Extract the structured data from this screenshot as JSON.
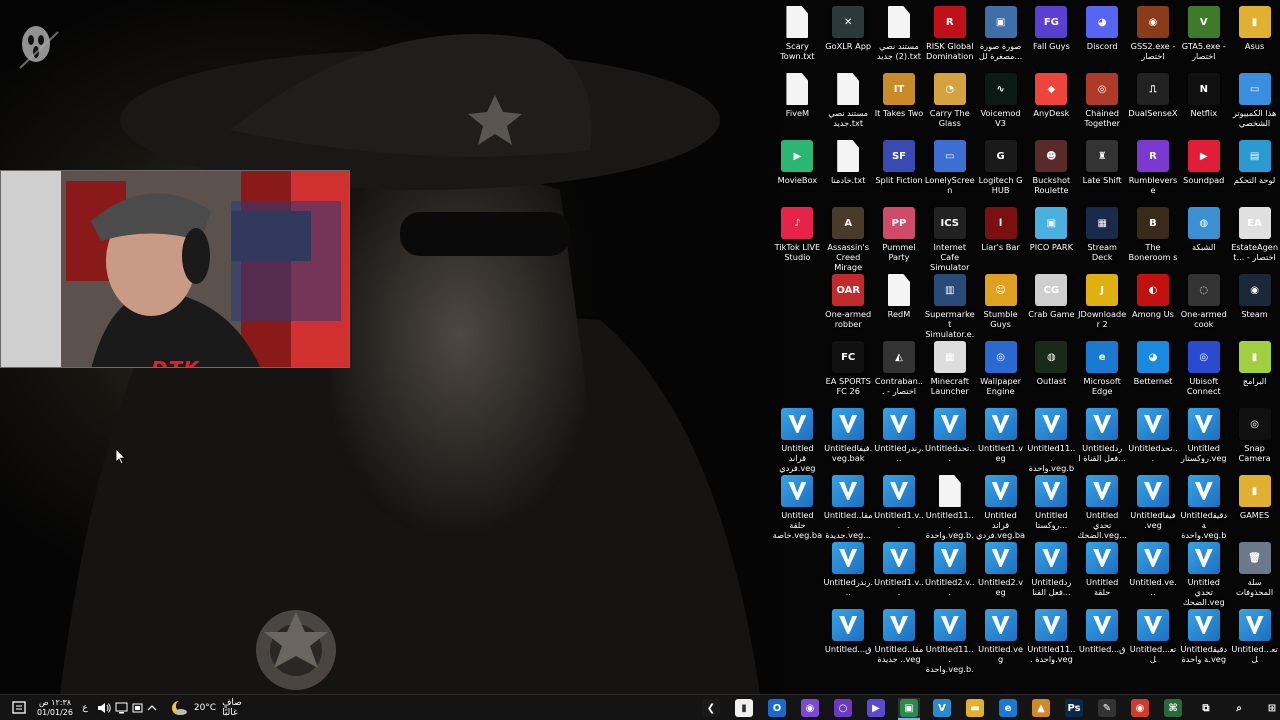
{
  "desktop": {
    "icons": [
      {
        "label": "Scary Town.txt",
        "kind": "doc"
      },
      {
        "label": "GoXLR App",
        "kind": "app",
        "color": "#2a3a3a",
        "glyph": "✕"
      },
      {
        "label": "مستند نصي (2) جديد.txt",
        "kind": "doc"
      },
      {
        "label": "RISK Global Domination",
        "kind": "app",
        "color": "#c0101a",
        "glyph": "R"
      },
      {
        "label": "صورة صورة مصغرة لل...",
        "kind": "app",
        "color": "#3f6fa8",
        "glyph": "▣"
      },
      {
        "label": "Fall Guys",
        "kind": "app",
        "color": "#5a3fd0",
        "glyph": "FG"
      },
      {
        "label": "Discord",
        "kind": "app",
        "color": "#5865f2",
        "glyph": "◕"
      },
      {
        "label": "GSS2.exe - اختصار",
        "kind": "app",
        "color": "#8a3b1a",
        "glyph": "◉"
      },
      {
        "label": "GTA5.exe - اختصار",
        "kind": "app",
        "color": "#3d7a2a",
        "glyph": "V"
      },
      {
        "label": "Asus",
        "kind": "app",
        "color": "#e0b030",
        "glyph": "▮"
      },
      {
        "label": "FiveM",
        "kind": "doc"
      },
      {
        "label": "مستند نصي جديد.txt",
        "kind": "doc"
      },
      {
        "label": "It Takes Two",
        "kind": "app",
        "color": "#c98a2a",
        "glyph": "IT"
      },
      {
        "label": "Carry The Glass",
        "kind": "app",
        "color": "#d4a340",
        "glyph": "◔"
      },
      {
        "label": "Voicemod V3",
        "kind": "app",
        "color": "#0c1a16",
        "glyph": "∿"
      },
      {
        "label": "AnyDesk",
        "kind": "app",
        "color": "#ef443b",
        "glyph": "◆"
      },
      {
        "label": "Chained Together",
        "kind": "app",
        "color": "#b03a2a",
        "glyph": "◎"
      },
      {
        "label": "DualSenseX",
        "kind": "app",
        "color": "#222",
        "glyph": "⎍"
      },
      {
        "label": "Netflix",
        "kind": "app",
        "color": "#111",
        "glyph": "N"
      },
      {
        "label": "هذا الكمبيوتر الشخصي",
        "kind": "app",
        "color": "#3a8ee0",
        "glyph": "▭"
      },
      {
        "label": "MovieBox",
        "kind": "app",
        "color": "#2bb673",
        "glyph": "▶"
      },
      {
        "label": "خادمنا.txt",
        "kind": "doc"
      },
      {
        "label": "Split Fiction",
        "kind": "app",
        "color": "#3a4ab0",
        "glyph": "SF"
      },
      {
        "label": "LonelyScreen",
        "kind": "app",
        "color": "#3d6fd0",
        "glyph": "▭"
      },
      {
        "label": "Logitech G HUB",
        "kind": "app",
        "color": "#1a1a1a",
        "glyph": "G"
      },
      {
        "label": "Buckshot Roulette",
        "kind": "app",
        "color": "#5a2a2a",
        "glyph": "☻"
      },
      {
        "label": "Late Shift",
        "kind": "app",
        "color": "#333",
        "glyph": "♜"
      },
      {
        "label": "Rumbleverse",
        "kind": "app",
        "color": "#7a3ad0",
        "glyph": "R"
      },
      {
        "label": "Soundpad",
        "kind": "app",
        "color": "#e01e3a",
        "glyph": "▶"
      },
      {
        "label": "لوحة التحكم",
        "kind": "app",
        "color": "#2a9ad0",
        "glyph": "▤"
      },
      {
        "label": "TikTok LIVE Studio",
        "kind": "app",
        "color": "#e6244a",
        "glyph": "♪"
      },
      {
        "label": "Assassin's Creed Mirage",
        "kind": "app",
        "color": "#4a3a2a",
        "glyph": "A"
      },
      {
        "label": "Pummel Party",
        "kind": "app",
        "color": "#d04a6a",
        "glyph": "PP"
      },
      {
        "label": "Internet Cafe Simulator 2...",
        "kind": "app",
        "color": "#222",
        "glyph": "ICS"
      },
      {
        "label": "Liar's Bar",
        "kind": "app",
        "color": "#7a1010",
        "glyph": "l"
      },
      {
        "label": "PICO PARK",
        "kind": "app",
        "color": "#4ab0e0",
        "glyph": "▣"
      },
      {
        "label": "Stream Deck",
        "kind": "app",
        "color": "#1a2a4a",
        "glyph": "▦"
      },
      {
        "label": "The Boneroom s",
        "kind": "app",
        "color": "#3a2a1a",
        "glyph": "B"
      },
      {
        "label": "الشبكة",
        "kind": "app",
        "color": "#3a90d0",
        "glyph": "◍"
      },
      {
        "label": "EstateAgent... - اختصار",
        "kind": "app",
        "color": "#e0e0e0",
        "glyph": "EA"
      },
      {
        "label": "",
        "kind": "empty"
      },
      {
        "label": "One-armed robber",
        "kind": "app",
        "color": "#c02a2a",
        "glyph": "OAR"
      },
      {
        "label": "RedM",
        "kind": "doc"
      },
      {
        "label": "Supermarket Simulator.e...",
        "kind": "app",
        "color": "#2a4a7a",
        "glyph": "▥"
      },
      {
        "label": "Stumble Guys",
        "kind": "app",
        "color": "#e0a020",
        "glyph": "☺"
      },
      {
        "label": "Crab Game",
        "kind": "app",
        "color": "#cfcfcf",
        "glyph": "CG"
      },
      {
        "label": "JDownloader 2",
        "kind": "app",
        "color": "#e0b010",
        "glyph": "J"
      },
      {
        "label": "Among Us",
        "kind": "app",
        "color": "#c01010",
        "glyph": "◐"
      },
      {
        "label": "One-armed cook",
        "kind": "app",
        "color": "#333",
        "glyph": "◌"
      },
      {
        "label": "Steam",
        "kind": "app",
        "color": "#1b2838",
        "glyph": "◉"
      },
      {
        "label": "",
        "kind": "empty"
      },
      {
        "label": "EA SPORTS FC 26",
        "kind": "app",
        "color": "#111",
        "glyph": "FC"
      },
      {
        "label": "Contraban... - اختصار",
        "kind": "app",
        "color": "#333",
        "glyph": "◭"
      },
      {
        "label": "Minecraft Launcher",
        "kind": "app",
        "color": "#ddd",
        "glyph": "▦"
      },
      {
        "label": "Wallpaper Engine",
        "kind": "app",
        "color": "#2a6ad0",
        "glyph": "◎"
      },
      {
        "label": "Outlast",
        "kind": "app",
        "color": "#1a2a1a",
        "glyph": "◍"
      },
      {
        "label": "Microsoft Edge",
        "kind": "app",
        "color": "#1a7ad0",
        "glyph": "e"
      },
      {
        "label": "Betternet",
        "kind": "app",
        "color": "#1a8ae0",
        "glyph": "◕"
      },
      {
        "label": "Ubisoft Connect",
        "kind": "app",
        "color": "#2a4ad0",
        "glyph": "◎"
      },
      {
        "label": "البرامج",
        "kind": "app",
        "color": "#a0d040",
        "glyph": "▮"
      },
      {
        "label": "Untitled قراند فردي.veg",
        "kind": "veg"
      },
      {
        "label": "Untitledفيفا.veg.bak",
        "kind": "veg"
      },
      {
        "label": "Untitledرندر...",
        "kind": "veg"
      },
      {
        "label": "Untitledتحد...",
        "kind": "veg"
      },
      {
        "label": "Untitled1.veg",
        "kind": "veg"
      },
      {
        "label": "Untitled11... واحدة.veg.bak",
        "kind": "veg"
      },
      {
        "label": "Untitledرد فعل القناة ا...",
        "kind": "veg"
      },
      {
        "label": "Untitledتحد...",
        "kind": "veg"
      },
      {
        "label": "Untitled روكستار.veg",
        "kind": "veg"
      },
      {
        "label": "Snap Camera",
        "kind": "app",
        "color": "#111",
        "glyph": "◎"
      },
      {
        "label": "Untitled حلقة خاصة.veg.bak",
        "kind": "veg"
      },
      {
        "label": "Untitledمقا... جديدة.veg...",
        "kind": "veg"
      },
      {
        "label": "Untitled1.v...",
        "kind": "veg"
      },
      {
        "label": "Untitled11... واحدة.veg.b...",
        "kind": "doc"
      },
      {
        "label": "Untitled قراند فردي.veg.bak",
        "kind": "veg"
      },
      {
        "label": "Untitled روكستا...",
        "kind": "veg"
      },
      {
        "label": "Untitled تحدي الضحك.veg...",
        "kind": "veg"
      },
      {
        "label": "Untitledفيفا .veg",
        "kind": "veg"
      },
      {
        "label": "Untitledدقيقة واحدة.veg.bak",
        "kind": "veg"
      },
      {
        "label": "GAMES",
        "kind": "app",
        "color": "#e0b030",
        "glyph": "▮"
      },
      {
        "label": "",
        "kind": "empty"
      },
      {
        "label": "Untitledرندر...",
        "kind": "veg"
      },
      {
        "label": "Untitled1.v...",
        "kind": "veg"
      },
      {
        "label": "Untitled2.v...",
        "kind": "veg"
      },
      {
        "label": "Untitled2.veg",
        "kind": "veg"
      },
      {
        "label": "Untitledرد فعل القنا...",
        "kind": "veg"
      },
      {
        "label": "Untitled حلقة خاصة.veg",
        "kind": "veg"
      },
      {
        "label": "Untitled.ve...",
        "kind": "veg"
      },
      {
        "label": "Untitled تحدي الضحك.veg",
        "kind": "veg"
      },
      {
        "label": "سلة المحذوفات",
        "kind": "app",
        "color": "#6a7a8a",
        "glyph": "🗑"
      },
      {
        "label": "",
        "kind": "empty"
      },
      {
        "label": "Untitled...ق",
        "kind": "veg"
      },
      {
        "label": "Untitledمقا... جديدة.veg",
        "kind": "veg"
      },
      {
        "label": "Untitled11... واحدة.veg.b...",
        "kind": "veg"
      },
      {
        "label": "Untitled.veg",
        "kind": "veg"
      },
      {
        "label": "Untitled11... واحدة.veg",
        "kind": "veg"
      },
      {
        "label": "Untitled...ق",
        "kind": "veg"
      },
      {
        "label": "Untitled...تعل",
        "kind": "veg"
      },
      {
        "label": "Untitledدقيقة واحدة.veg",
        "kind": "veg"
      },
      {
        "label": "Untitled...تعل",
        "kind": "veg"
      }
    ]
  },
  "webcam": {
    "brand_text": "DTK"
  },
  "taskbar": {
    "clock_time": "١٢:٣٨ ص",
    "clock_date": "01/01/26",
    "lang": "ع",
    "weather_temp": "20°C",
    "weather_text": "صافٍ غالبًا",
    "notification_icon": "notification-icon",
    "pinned": [
      {
        "name": "teamviewer",
        "color": "#1a1a1a",
        "glyph": "❮"
      },
      {
        "name": "notepad",
        "color": "#f0f0f0",
        "glyph": "▮"
      },
      {
        "name": "outlook",
        "color": "#1a6ad0",
        "glyph": "O"
      },
      {
        "name": "app-purple",
        "color": "#7a4ad0",
        "glyph": "◉"
      },
      {
        "name": "cortana",
        "color": "#6a3ac0",
        "glyph": "○"
      },
      {
        "name": "media-player",
        "color": "#5a4ad0",
        "glyph": "▶"
      },
      {
        "name": "app-active",
        "color": "#2a8a4a",
        "glyph": "▣"
      },
      {
        "name": "vegas",
        "color": "#2a8ad0",
        "glyph": "V"
      },
      {
        "name": "file-explorer",
        "color": "#e0b030",
        "glyph": "▬"
      },
      {
        "name": "edge",
        "color": "#1a7ad0",
        "glyph": "e"
      },
      {
        "name": "app-orange",
        "color": "#d08a2a",
        "glyph": "▲"
      },
      {
        "name": "photoshop",
        "color": "#0a2a4a",
        "glyph": "Ps"
      },
      {
        "name": "app-mail",
        "color": "#333",
        "glyph": "✎"
      },
      {
        "name": "chrome",
        "color": "#d03a2a",
        "glyph": "◉"
      },
      {
        "name": "app-green",
        "color": "#2a6a3a",
        "glyph": "⌘"
      },
      {
        "name": "task-view",
        "color": "#141414",
        "glyph": "⧉"
      },
      {
        "name": "search",
        "color": "#141414",
        "glyph": "⌕"
      },
      {
        "name": "start",
        "color": "#141414",
        "glyph": "⊞"
      }
    ]
  }
}
